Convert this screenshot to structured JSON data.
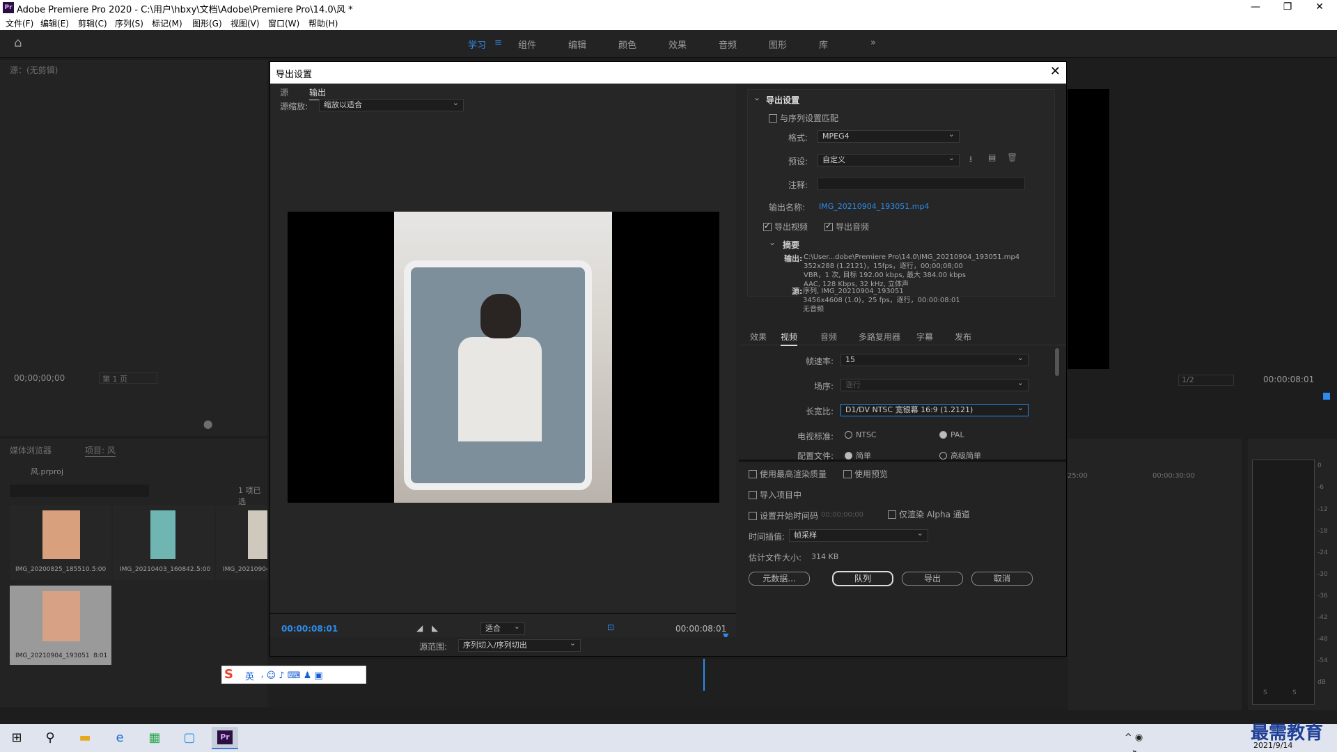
{
  "app": {
    "title": "Adobe Premiere Pro 2020 - C:\\用户\\hbxy\\文档\\Adobe\\Premiere Pro\\14.0\\风 *"
  },
  "menu": [
    "文件(F)",
    "编辑(E)",
    "剪辑(C)",
    "序列(S)",
    "标记(M)",
    "图形(G)",
    "视图(V)",
    "窗口(W)",
    "帮助(H)"
  ],
  "workspaces": [
    "学习",
    "组件",
    "编辑",
    "颜色",
    "效果",
    "音频",
    "图形",
    "库"
  ],
  "source_panel": {
    "title": "源：(无剪辑)",
    "timecode": "00;00;00;00",
    "page": "第 1 页"
  },
  "project_panel": {
    "tab1": "媒体浏览器",
    "tab2": "项目: 风",
    "file": "风.prproj",
    "count": "1 项已选",
    "items": [
      {
        "name": "IMG_20200825_185510...",
        "dur": "5:00"
      },
      {
        "name": "IMG_20210403_160842...",
        "dur": "5:00"
      },
      {
        "name": "IMG_20210904_...",
        "dur": ""
      },
      {
        "name": "IMG_20210904_193051",
        "dur": "8:01"
      }
    ]
  },
  "program_panel": {
    "timecode": "00:00:08:01",
    "fraction": "1/2"
  },
  "timeline": {
    "t1": "25:00",
    "t2": "00:00:30:00"
  },
  "meter": {
    "ticks": [
      "0",
      "-6",
      "-12",
      "-18",
      "-24",
      "-30",
      "-36",
      "-42",
      "-48",
      "-54",
      "dB"
    ],
    "s1": "S",
    "s2": "S"
  },
  "ime": {
    "lang": "英"
  },
  "dialog": {
    "title": "导出设置",
    "tabs": {
      "source": "源",
      "output": "输出"
    },
    "scale_label": "源缩放:",
    "scale_value": "缩放以适合",
    "timecode_start": "00:00:08:01",
    "timecode_end": "00:00:08:01",
    "fit": "适合",
    "range_label": "源范围:",
    "range_value": "序列切入/序列切出",
    "export": {
      "header": "导出设置",
      "match_seq": "与序列设置匹配",
      "format_label": "格式:",
      "format_value": "MPEG4",
      "preset_label": "预设:",
      "preset_value": "自定义",
      "comment_label": "注释:",
      "output_name_label": "输出名称:",
      "output_name": "IMG_20210904_193051.mp4",
      "export_video": "导出视频",
      "export_audio": "导出音频",
      "summary_header": "摘要",
      "summary_out_label": "输出:",
      "summary_out": [
        "C:\\User...dobe\\Premiere Pro\\14.0\\IMG_20210904_193051.mp4",
        "352x288 (1.2121)，15fps，逐行，00;00;08;00",
        "VBR，1 次, 目标 192.00 kbps, 最大 384.00 kbps",
        "AAC, 128 Kbps, 32 kHz, 立体声"
      ],
      "summary_src_label": "源:",
      "summary_src": [
        "序列, IMG_20210904_193051",
        "3456x4608 (1.0)，25 fps，逐行，00:00:08:01",
        "无音频"
      ]
    },
    "subtabs": [
      "效果",
      "视频",
      "音频",
      "多路复用器",
      "字幕",
      "发布"
    ],
    "video": {
      "fps_label": "帧速率:",
      "fps_value": "15",
      "field_label": "场序:",
      "field_value": "逐行",
      "aspect_label": "长宽比:",
      "aspect_value": "D1/DV NTSC 宽银幕 16:9 (1.2121)",
      "tv_label": "电视标准:",
      "ntsc": "NTSC",
      "pal": "PAL",
      "profile_label": "配置文件:",
      "profile_a": "简单",
      "profile_b": "高级简单"
    },
    "bottom": {
      "max_quality": "使用最高渲染质量",
      "use_preview": "使用预览",
      "import_proj": "导入项目中",
      "start_tc": "设置开始时间码",
      "start_tc_value": "00;00;00;00",
      "alpha": "仅渲染 Alpha 通道",
      "interp_label": "时间插值:",
      "interp_value": "帧采样",
      "size_label": "估计文件大小:",
      "size_value": "314 KB",
      "metadata": "元数据...",
      "queue": "队列",
      "export": "导出",
      "cancel": "取消"
    }
  },
  "watermark": {
    "text": "最需教育",
    "date": "2021/9/14"
  }
}
